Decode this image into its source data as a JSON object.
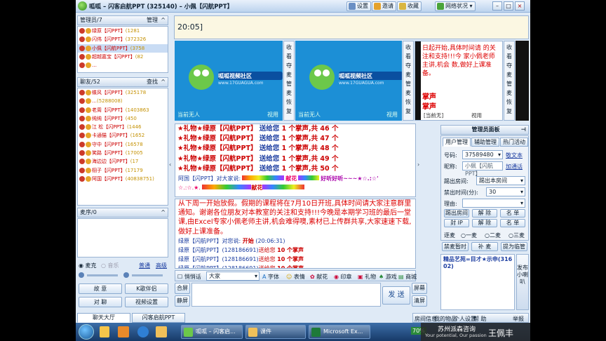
{
  "window": {
    "title": "呱呱 – 闪客启航PPT (325140) – 小佩【闪航PPT】"
  },
  "toolbar": {
    "settings": "设置",
    "invite": "邀请",
    "favorite": "收藏",
    "network": "网络状况 ▾"
  },
  "managers": {
    "header": "管理员/7",
    "action": "管理",
    "items": [
      {
        "name": "绿原【闪PPT】",
        "id": "(1281"
      },
      {
        "name": "闪伟【闪PPT】",
        "id": "(372326"
      },
      {
        "name": "小佩【闪航PPT】",
        "id": "(3758"
      },
      {
        "name": "超越嘉宝【闪PPT】",
        "id": "(82"
      },
      {
        "name": "…",
        "id": ""
      }
    ]
  },
  "guests": {
    "header": "聊友/52",
    "action": "查找",
    "items": [
      {
        "name": "蝶风【闪PPT】",
        "id": "(325178"
      },
      {
        "name": "…",
        "id": "(5288008)"
      },
      {
        "name": "老周【闪PPT】",
        "id": "(1403863"
      },
      {
        "name": "纯纯【闪PPT】",
        "id": "(450"
      },
      {
        "name": "江 松【闪PPT】",
        "id": "(1446"
      },
      {
        "name": "卡通猫【闪PPT】",
        "id": "(1652"
      },
      {
        "name": "守中【闪PPT】",
        "id": "(16578"
      },
      {
        "name": "笑路【闪PPT】",
        "id": "(17005"
      },
      {
        "name": "海边边【闪PPT】",
        "id": "(17"
      },
      {
        "name": "栩子【闪PPT】",
        "id": "(17179"
      },
      {
        "name": "阿国【闪PPT】",
        "id": "(40838751)"
      }
    ]
  },
  "queue": {
    "header": "麦序/0"
  },
  "audio": {
    "mic": "麦克",
    "speaker": "音乐",
    "mode": "普通",
    "advanced": "高级"
  },
  "left_buttons": {
    "broadcast": "故 意",
    "karaoke": "K歌伴侣",
    "private": "对 聊",
    "video_settings": "视频设置"
  },
  "bottom_tabs": {
    "lobby": "聊天大厅",
    "room": "闪客启航PPT"
  },
  "announcement": {
    "text": "20:05]"
  },
  "video": {
    "side_labels": [
      "收",
      "看",
      "夺",
      "麦",
      "管",
      "麦",
      "恢",
      "复"
    ],
    "slot1": {
      "caption": "当前无人",
      "status": "视用"
    },
    "slot2": {
      "caption": "当前无人",
      "status": "视用"
    },
    "logo_text": "呱呱视频社区",
    "logo_url": "www.17GUAGUA.com"
  },
  "ppt": {
    "text": "日起开始,具体时间请 的关注和支持!!!今 家小佩老师主讲,机会 数,做好上课准备。",
    "applause1": "掌声",
    "applause2": "掌声",
    "btn1": "[当前无]",
    "btn2": "视用"
  },
  "gift_lines": [
    {
      "sender": "★礼物★绿原【闪航PPT】",
      "verb": "送给您",
      "text": "1 个掌声,共 46 个"
    },
    {
      "sender": "★礼物★绿原【闪航PPT】",
      "verb": "送给您",
      "text": "1 个掌声,共 47 个"
    },
    {
      "sender": "★礼物★绿原【闪航PPT】",
      "verb": "送给您",
      "text": "1 个掌声,共 48 个"
    },
    {
      "sender": "★礼物★绿原【闪航PPT】",
      "verb": "送给您",
      "text": "1 个掌声,共 49 个"
    },
    {
      "sender": "★礼物★绿原【闪航PPT】",
      "verb": "送给您",
      "text": "1 个掌声,共 50 个"
    }
  ],
  "fan_line": {
    "who": "阿国【闪PPT】对大家说:",
    "flower1": "献花",
    "flower2": "献花",
    "cheer": "好听好听~~~★☆.:☆'"
  },
  "public_text": "从下周一开始放假。假期的课程将在7月10日开班,具体时间请大家注意群里通知。谢谢各位朋友对本教室的关注和支持!!!今晚是本期学习班的最后一堂课,由Excel专家小佩老师主讲,机会难得噢,素材已上传群共享,大家速速下载,做好上课准备。",
  "chat_lines": [
    {
      "who": "绿原【闪航PPT】对您说:",
      "text": "开始",
      "time": "(20:06:31)"
    },
    {
      "who": "绿原【闪航PPT】(128186691)",
      "verb": "送给您",
      "text": "10 个掌声"
    },
    {
      "who": "绿原【闪航PPT】(128186691)",
      "verb": "送给您",
      "text": "10 个掌声"
    },
    {
      "who": "绿原【闪航PPT】(128186691)",
      "verb": "送给您",
      "text": "10 个掌声"
    }
  ],
  "input_bar": {
    "whisper": "悄悄话",
    "target": "大家",
    "font": "字体",
    "emoji": "表情",
    "flower": "献花",
    "stamp": "印章",
    "gift": "礼物",
    "game": "游戏",
    "mall": "商城"
  },
  "send": {
    "label": "发 送",
    "screen": "屏幕",
    "clear": "清屏",
    "kick": "合屏",
    "mute": "静屏"
  },
  "admin": {
    "title": "管理员面板",
    "tabs": [
      "用户管理",
      "辅助管理",
      "热门活动"
    ],
    "id_label": "号码:",
    "id_value": "37589480",
    "nick_label": "昵称:",
    "nick_value": "小佩【闪航PPT】",
    "action1": "敬文本",
    "action2": "加通话",
    "kick_label": "踢出房间:",
    "kick_value": "踢出本房间",
    "ban_label": "禁出时间(分):",
    "ban_value": "30",
    "reason_label": "理由:",
    "btns": [
      "踢出房间",
      "解 除",
      "名 单",
      "封 IP",
      "解 除",
      "名 单"
    ],
    "mic_label": "逐麦",
    "mic1": "一麦",
    "mic2": "二麦",
    "mic3": "三麦",
    "b1": "禁麦暂时",
    "b2": "补 麦",
    "b3": "提为临管"
  },
  "ad": {
    "title": "精品艺苑=目才★示申(316 02)",
    "side": "发布小喇叭"
  },
  "footer": {
    "items": [
      "房间信息",
      "我的物品",
      "个人设置",
      "帮 助",
      "",
      "举报"
    ]
  },
  "taskbar": {
    "items": [
      "呱呱 – 闪客启...",
      "课件",
      "Microsoft Ex...",
      "70%"
    ],
    "watermark_top": "苏州派森咨询",
    "watermark_sub": "Your potential, Our passion",
    "person": "王佩丰"
  }
}
